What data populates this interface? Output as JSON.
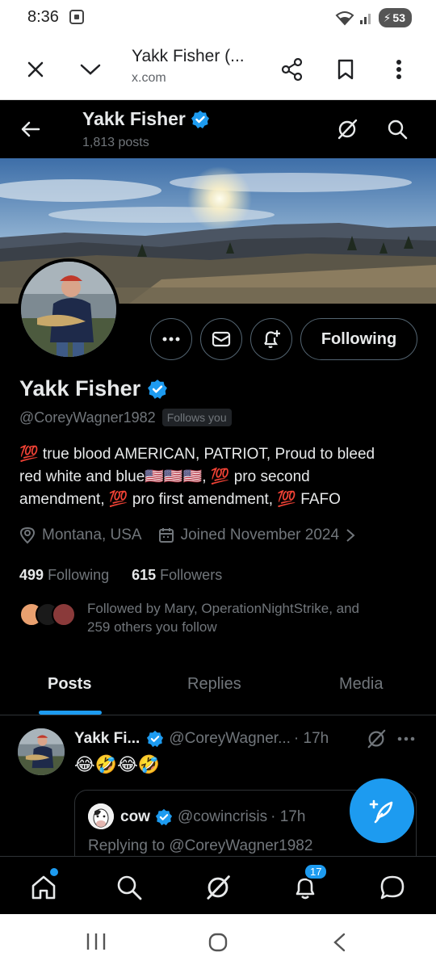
{
  "status_bar": {
    "time": "8:36",
    "battery": "53"
  },
  "browser": {
    "title": "Yakk Fisher (...",
    "url": "x.com"
  },
  "header": {
    "name": "Yakk Fisher",
    "posts_count": "1,813 posts"
  },
  "profile": {
    "name": "Yakk Fisher",
    "handle": "@CoreyWagner1982",
    "follows_you": "Follows you",
    "bio_line1": "💯 true blood AMERICAN, PATRIOT, Proud to bleed",
    "bio_line2": "red white and blue🇺🇸🇺🇸🇺🇸, 💯 pro second",
    "bio_line3": "amendment, 💯 pro first amendment, 💯 FAFO",
    "location": "Montana, USA",
    "joined": "Joined November 2024",
    "following_count": "499",
    "following_label": "Following",
    "followers_count": "615",
    "followers_label": "Followers",
    "followed_by_line1": "Followed by Mary, OperationNightStrike, and",
    "followed_by_line2": "259 others you follow",
    "following_button": "Following"
  },
  "tabs": [
    "Posts",
    "Replies",
    "Media"
  ],
  "tweet": {
    "name": "Yakk Fi...",
    "handle": "@CoreyWagner...",
    "time": "· 17h",
    "text": "😂🤣😂🤣",
    "quote": {
      "name": "cow",
      "handle": "@cowincrisis",
      "time": "· 17h",
      "reply_text": "Replying to @CoreyWagner1982"
    }
  },
  "nav": {
    "notifications_badge": "17"
  },
  "colors": {
    "accent": "#1d9bf0",
    "background": "#000000",
    "secondary_text": "#71767b"
  }
}
